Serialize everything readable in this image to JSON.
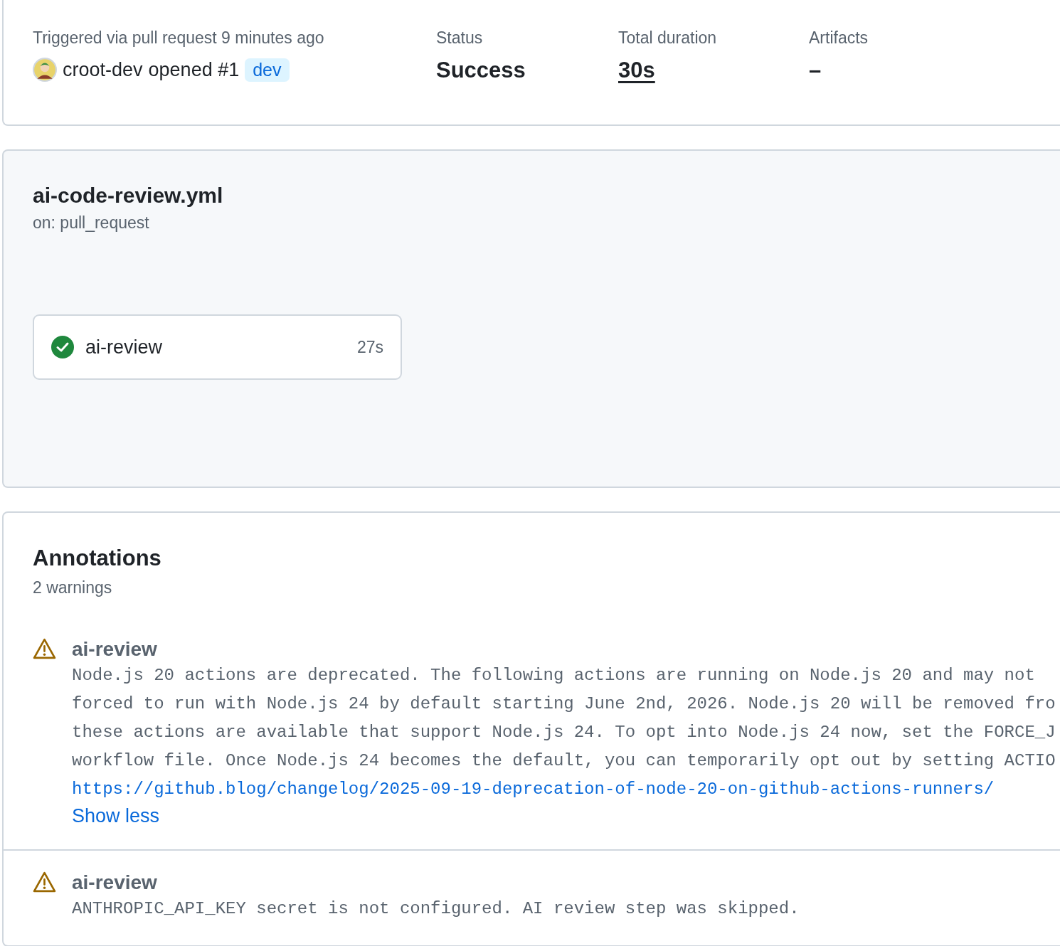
{
  "summary": {
    "trigger_label": "Triggered via pull request 9 minutes ago",
    "actor": "croot-dev",
    "action": "opened #1",
    "branch": "dev",
    "status_label": "Status",
    "status": "Success",
    "duration_label": "Total duration",
    "duration": "30s",
    "artifacts_label": "Artifacts",
    "artifacts": "–"
  },
  "workflow": {
    "file": "ai-code-review.yml",
    "trigger": "on: pull_request",
    "jobs": [
      {
        "name": "ai-review",
        "duration": "27s",
        "kind": "success"
      }
    ]
  },
  "annotations": {
    "title": "Annotations",
    "count": "2 warnings",
    "items": [
      {
        "kind": "warning",
        "job": "ai-review",
        "lines": [
          "Node.js 20 actions are deprecated. The following actions are running on Node.js 20 and may not",
          "forced to run with Node.js 24 by default starting June 2nd, 2026. Node.js 20 will be removed fro",
          "these actions are available that support Node.js 24. To opt into Node.js 24 now, set the FORCE_J",
          "workflow file. Once Node.js 24 becomes the default, you can temporarily opt out by setting ACTIO"
        ],
        "link": "https://github.blog/changelog/2025-09-19-deprecation-of-node-20-on-github-actions-runners/",
        "toggle": "Show less"
      },
      {
        "kind": "warning",
        "job": "ai-review",
        "lines": [
          "ANTHROPIC_API_KEY secret is not configured. AI review step was skipped."
        ]
      }
    ]
  }
}
